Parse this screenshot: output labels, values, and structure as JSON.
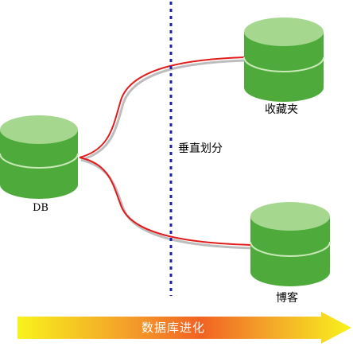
{
  "nodes": {
    "db": {
      "label": "DB"
    },
    "favorites": {
      "label": "收藏夹"
    },
    "blog": {
      "label": "博客"
    }
  },
  "divider": {
    "label": "垂直划分"
  },
  "arrow": {
    "label": "数据库进化"
  },
  "colors": {
    "cylinder_top": "#a6d78f",
    "cylinder_body": "#4faa3c",
    "cylinder_dark": "#3d8f2e",
    "connector": "#e21b1b",
    "connector_shadow": "#b8b8b8",
    "divider": "#1a22a8",
    "arrow_start": "#f7f21f",
    "arrow_mid": "#f36a24",
    "arrow_end": "#f7f21f"
  }
}
